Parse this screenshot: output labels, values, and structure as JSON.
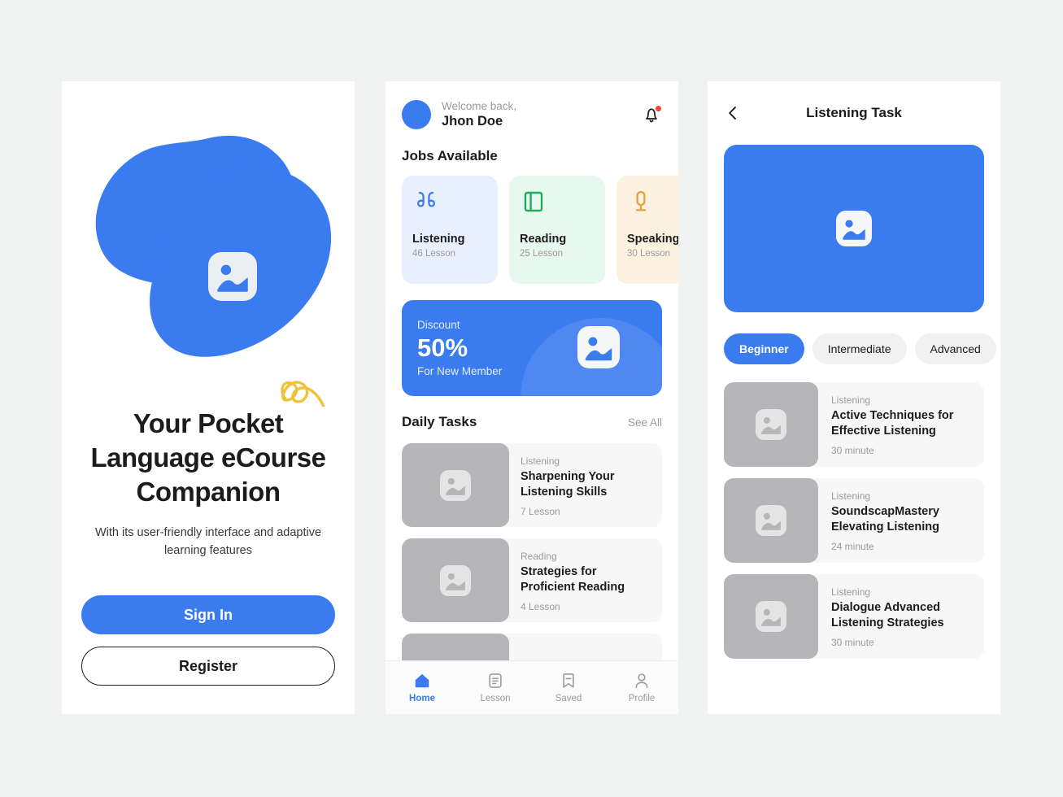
{
  "theme": {
    "accent": "#3b7bf0",
    "page_bg": "#f1f2f2",
    "card_bg": "#f7f7f8",
    "thumb_gray": "#b6b6b8",
    "muted_text": "#9a9a9e",
    "dark_text": "#1c1c1e",
    "badge_red": "#f0452f",
    "arrow_yellow": "#f0c23c"
  },
  "onboarding": {
    "hero_icon": "image-placeholder-icon",
    "title": "Your Pocket Language eCourse Companion",
    "subtitle": "With its user-friendly interface and adaptive learning features",
    "primary_button": "Sign In",
    "secondary_button": "Register"
  },
  "home": {
    "greeting_line1": "Welcome back,",
    "user_name": "Jhon Doe",
    "notification_icon": "bell-icon",
    "jobs_section_title": "Jobs Available",
    "jobs": [
      {
        "name": "Listening",
        "count": "46 Lesson",
        "icon": "earbuds-icon",
        "bg": "#e8f0fd",
        "icon_color": "#3b7bf0"
      },
      {
        "name": "Reading",
        "count": "25 Lesson",
        "icon": "book-icon",
        "bg": "#e7f8ee",
        "icon_color": "#22a95e"
      },
      {
        "name": "Speaking",
        "count": "30 Lesson",
        "icon": "microphone-icon",
        "bg": "#fdf2e0",
        "icon_color": "#e9a23b"
      }
    ],
    "promo": {
      "label": "Discount",
      "amount": "50%",
      "note": "For New Member",
      "icon": "image-placeholder-icon"
    },
    "daily_section_title": "Daily Tasks",
    "see_all": "See All",
    "daily_tasks": [
      {
        "category": "Listening",
        "title": "Sharpening Your Listening Skills",
        "meta": "7 Lesson"
      },
      {
        "category": "Reading",
        "title": "Strategies for Proficient Reading",
        "meta": "4 Lesson"
      }
    ],
    "tabs": [
      {
        "label": "Home",
        "icon": "home-icon",
        "active": true
      },
      {
        "label": "Lesson",
        "icon": "document-icon",
        "active": false
      },
      {
        "label": "Saved",
        "icon": "bookmark-icon",
        "active": false
      },
      {
        "label": "Profile",
        "icon": "person-icon",
        "active": false
      }
    ]
  },
  "task": {
    "back_icon": "chevron-left-icon",
    "title": "Listening Task",
    "banner_icon": "image-placeholder-icon",
    "levels": [
      {
        "label": "Beginner",
        "active": true
      },
      {
        "label": "Intermediate",
        "active": false
      },
      {
        "label": "Advanced",
        "active": false
      }
    ],
    "lessons": [
      {
        "category": "Listening",
        "title": "Active Techniques for Effective Listening",
        "meta": "30 minute"
      },
      {
        "category": "Listening",
        "title": "SoundscapMastery Elevating Listening",
        "meta": "24 minute"
      },
      {
        "category": "Listening",
        "title": "Dialogue Advanced Listening Strategies",
        "meta": "30 minute"
      }
    ]
  }
}
